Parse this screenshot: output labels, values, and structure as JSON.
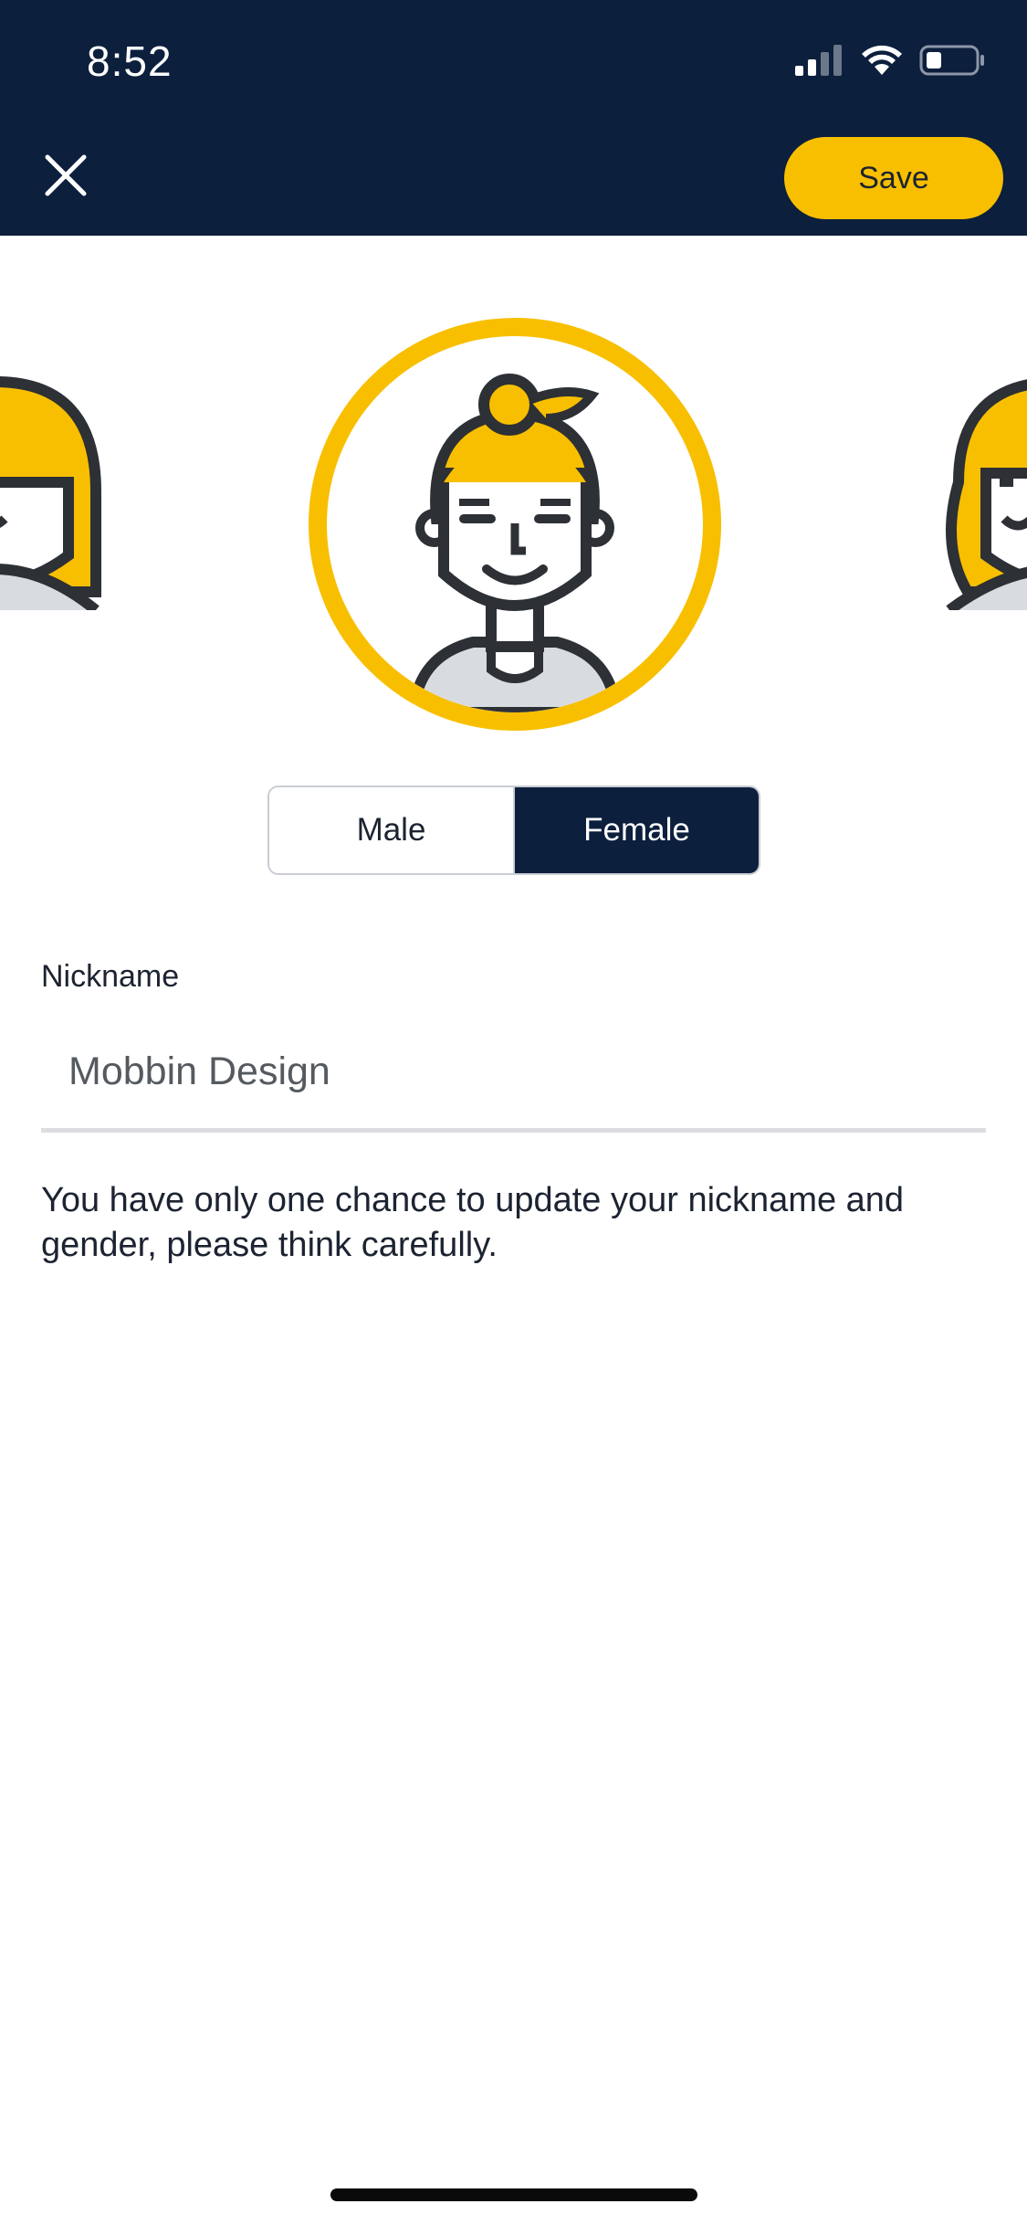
{
  "status_bar": {
    "time": "8:52",
    "icons": [
      "signal-icon",
      "wifi-icon",
      "battery-icon"
    ]
  },
  "header": {
    "close_icon": "close-icon",
    "save_label": "Save"
  },
  "avatars": {
    "items": [
      "female-avatar-short-hair",
      "female-avatar-ponytail",
      "female-avatar-wavy-hair"
    ],
    "selected": "female-avatar-ponytail"
  },
  "gender": {
    "options": [
      "Male",
      "Female"
    ],
    "selected": "Female"
  },
  "nickname": {
    "label": "Nickname",
    "value": "Mobbin Design"
  },
  "note": "You have only one chance to update your nickname and gender, please think carefully.",
  "colors": {
    "header": "#0c1f3d",
    "accent": "#f8bf00",
    "text": "#1c2331"
  }
}
